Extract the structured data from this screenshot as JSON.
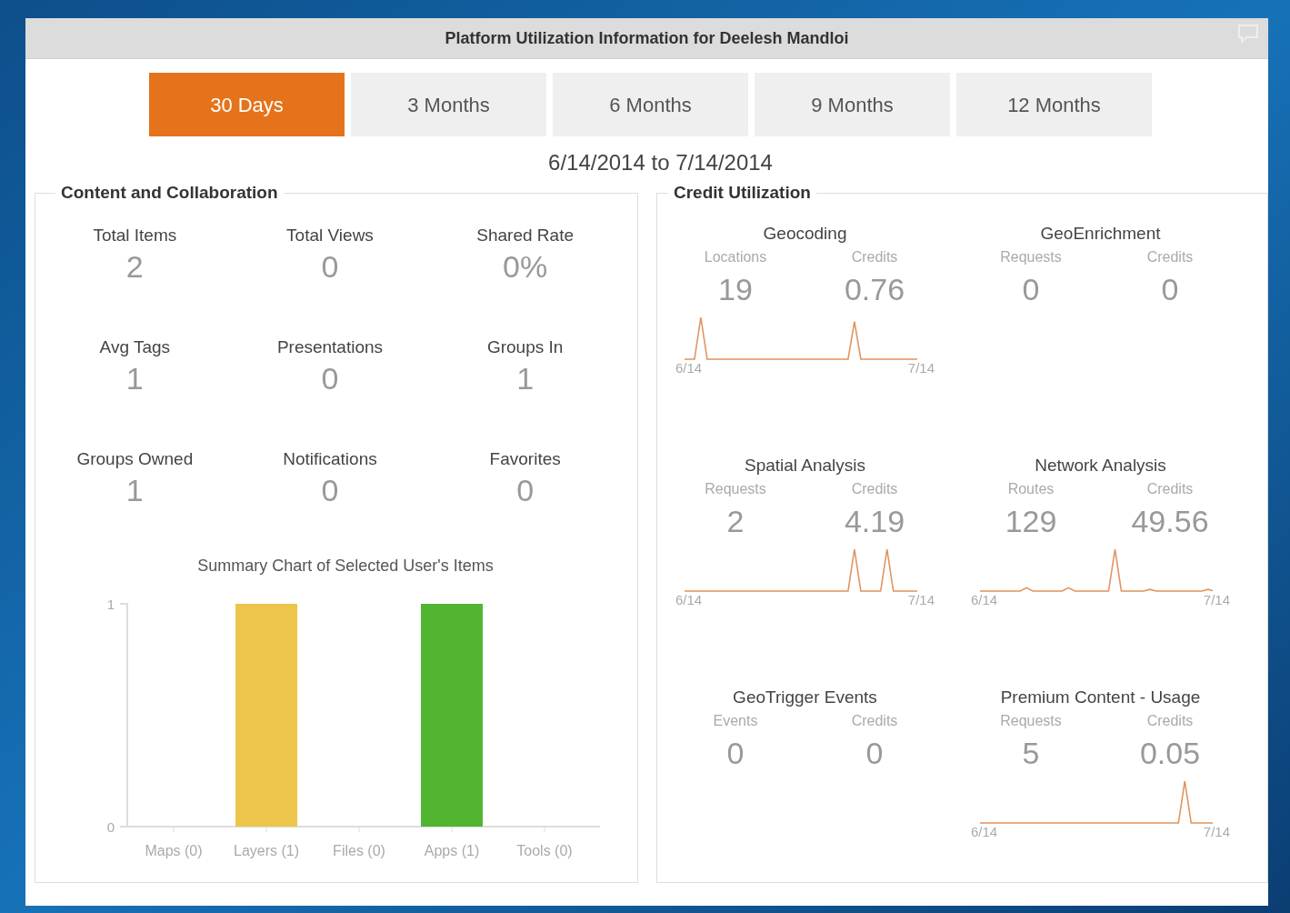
{
  "window": {
    "title": "Platform Utilization Information for Deelesh Mandloi"
  },
  "tabs": [
    {
      "label": "30 Days",
      "selected": true
    },
    {
      "label": "3 Months",
      "selected": false
    },
    {
      "label": "6 Months",
      "selected": false
    },
    {
      "label": "9 Months",
      "selected": false
    },
    {
      "label": "12 Months",
      "selected": false
    }
  ],
  "date_range": "6/14/2014 to 7/14/2014",
  "content": {
    "title": "Content and Collaboration",
    "stats": [
      {
        "label": "Total Items",
        "value": "2"
      },
      {
        "label": "Total Views",
        "value": "0"
      },
      {
        "label": "Shared Rate",
        "value": "0%"
      },
      {
        "label": "Avg Tags",
        "value": "1"
      },
      {
        "label": "Presentations",
        "value": "0"
      },
      {
        "label": "Groups In",
        "value": "1"
      },
      {
        "label": "Groups Owned",
        "value": "1"
      },
      {
        "label": "Notifications",
        "value": "0"
      },
      {
        "label": "Favorites",
        "value": "0"
      }
    ],
    "chart_data": {
      "type": "bar",
      "title": "Summary Chart of Selected User's Items",
      "categories": [
        "Maps (0)",
        "Layers (1)",
        "Files (0)",
        "Apps (1)",
        "Tools (0)"
      ],
      "stacked": true,
      "ylim": [
        0,
        1
      ],
      "yticks": [
        0,
        1
      ],
      "series": [
        {
          "color": "#ecc54a",
          "values": [
            null,
            1,
            null,
            null,
            null
          ]
        },
        {
          "color": "#52b532",
          "values": [
            null,
            null,
            null,
            1,
            null
          ]
        }
      ]
    }
  },
  "credits": {
    "title": "Credit Utilization",
    "cards": [
      {
        "title": "Geocoding",
        "label_1": "Locations",
        "value_1": "19",
        "label_2": "Credits",
        "value_2": "0.76",
        "axis_start": "6/14",
        "axis_end": "7/14"
      },
      {
        "title": "GeoEnrichment",
        "label_1": "Requests",
        "value_1": "0",
        "label_2": "Credits",
        "value_2": "0"
      },
      {
        "title": "Spatial Analysis",
        "label_1": "Requests",
        "value_1": "2",
        "label_2": "Credits",
        "value_2": "4.19",
        "axis_start": "6/14",
        "axis_end": "7/14"
      },
      {
        "title": "Network Analysis",
        "label_1": "Routes",
        "value_1": "129",
        "label_2": "Credits",
        "value_2": "49.56",
        "axis_start": "6/14",
        "axis_end": "7/14"
      },
      {
        "title": "GeoTrigger Events",
        "label_1": "Events",
        "value_1": "0",
        "label_2": "Credits",
        "value_2": "0"
      },
      {
        "title": "Premium Content - Usage",
        "label_1": "Requests",
        "value_1": "5",
        "label_2": "Credits",
        "value_2": "0.05",
        "axis_start": "6/14",
        "axis_end": "7/14"
      }
    ]
  }
}
